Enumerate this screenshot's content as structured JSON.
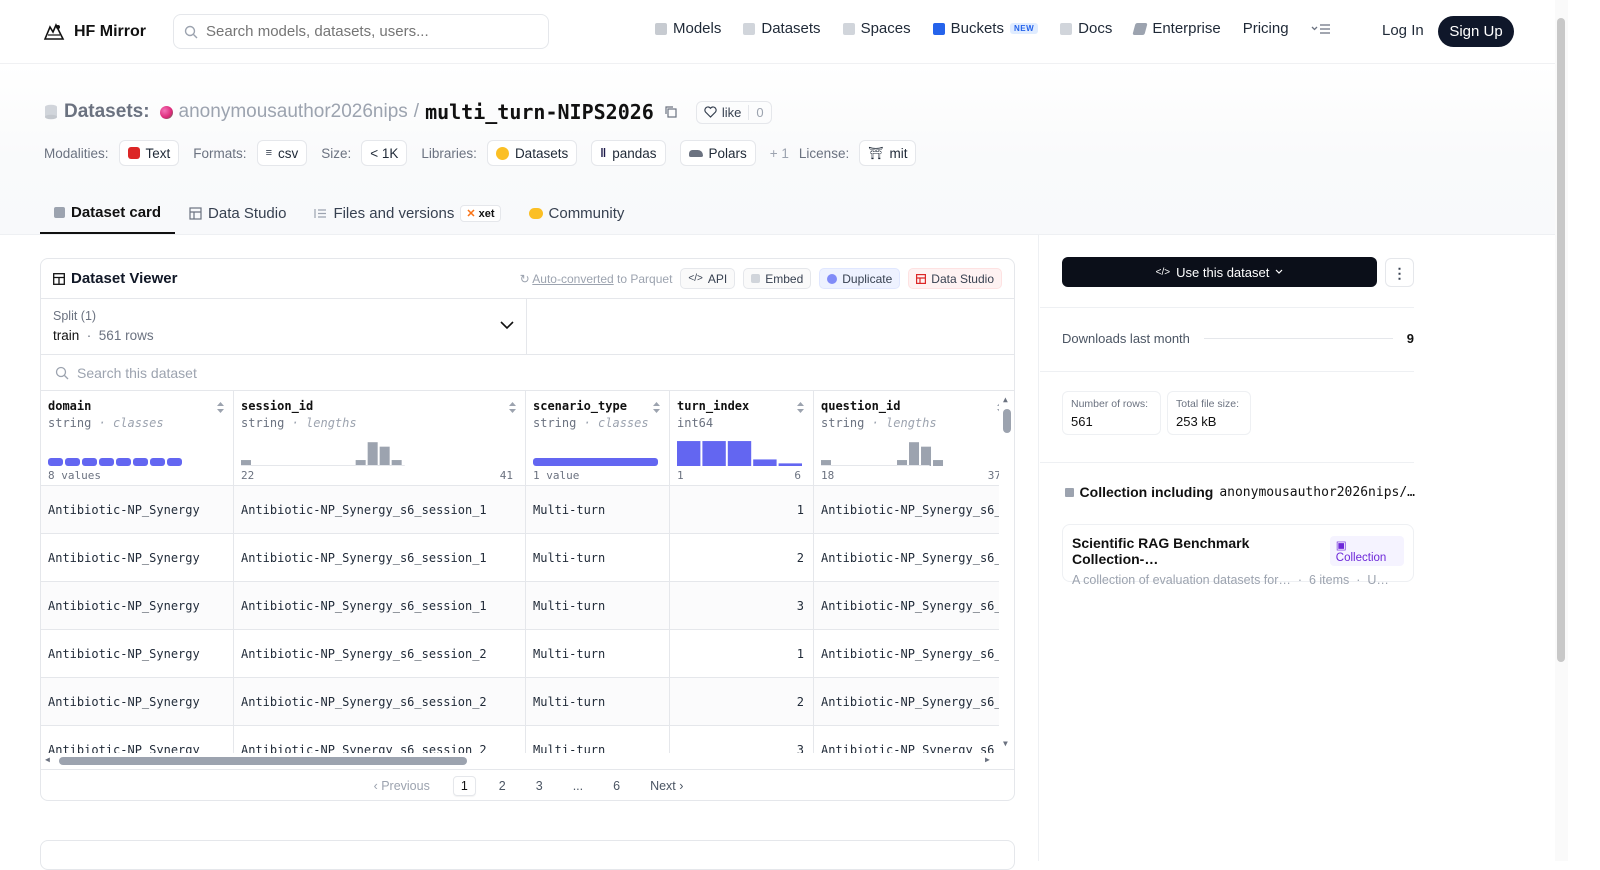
{
  "nav": {
    "brand": "HF Mirror",
    "search_placeholder": "Search models, datasets, users...",
    "items": [
      {
        "label": "Models",
        "icon": "cube-icon",
        "color": "#9ca3af"
      },
      {
        "label": "Datasets",
        "icon": "database-icon",
        "color": "#9ca3af"
      },
      {
        "label": "Spaces",
        "icon": "grid-icon",
        "color": "#9ca3af"
      },
      {
        "label": "Buckets",
        "icon": "bucket-icon",
        "color": "#2563eb",
        "badge": "NEW"
      },
      {
        "label": "Docs",
        "icon": "book-icon",
        "color": "#9ca3af"
      },
      {
        "label": "Enterprise",
        "icon": "enterprise-icon",
        "color": "#6b7280"
      },
      {
        "label": "Pricing"
      }
    ],
    "login": "Log In",
    "signup": "Sign Up"
  },
  "header": {
    "section": "Datasets:",
    "owner": "anonymousauthor2026nips",
    "slash": "/",
    "repo": "multi_turn-NIPS2026",
    "like_label": "like",
    "like_count": "0",
    "meta": {
      "modalities_label": "Modalities:",
      "modality": "Text",
      "formats_label": "Formats:",
      "format": "csv",
      "size_label": "Size:",
      "size": "< 1K",
      "libraries_label": "Libraries:",
      "libraries": [
        "Datasets",
        "pandas",
        "Polars"
      ],
      "more_libs": "+ 1",
      "license_label": "License:",
      "license": "mit"
    }
  },
  "tabs": [
    {
      "label": "Dataset card",
      "active": true
    },
    {
      "label": "Data Studio"
    },
    {
      "label": "Files and versions",
      "badge": "xet"
    },
    {
      "label": "Community"
    }
  ],
  "viewer": {
    "title": "Dataset Viewer",
    "auto_converted": "Auto-converted",
    "to_parquet": "to Parquet",
    "buttons": [
      "API",
      "Embed",
      "Duplicate",
      "Data Studio"
    ],
    "split_label": "Split (1)",
    "split_name": "train",
    "split_dot": "·",
    "split_rows": "561 rows",
    "search_placeholder": "Search this dataset",
    "columns": [
      {
        "name": "domain",
        "type": "string",
        "kind": "classes",
        "min": "8 values",
        "max": "",
        "hist_kind": "classes",
        "bars": [
          1,
          1,
          1,
          1,
          1,
          1,
          1,
          1
        ]
      },
      {
        "name": "session_id",
        "type": "string",
        "kind": "lengths",
        "min": "22",
        "max": "41",
        "hist_kind": "bars",
        "bars": [
          0.2,
          0,
          0,
          0,
          0,
          0.2,
          0.8,
          0.65,
          0.2
        ]
      },
      {
        "name": "scenario_type",
        "type": "string",
        "kind": "classes",
        "min": "1 value",
        "max": "",
        "hist_kind": "classes",
        "bars": [
          1
        ]
      },
      {
        "name": "turn_index",
        "type": "int64",
        "kind": "",
        "min": "1",
        "max": "6",
        "hist_kind": "num",
        "bars": [
          0.95,
          0.95,
          0.95,
          0.25,
          0.1
        ]
      },
      {
        "name": "question_id",
        "type": "string",
        "kind": "lengths",
        "min": "18",
        "max": "37",
        "hist_kind": "bars",
        "bars": [
          0.2,
          0,
          0,
          0,
          0,
          0.2,
          0.8,
          0.65,
          0.2
        ]
      }
    ],
    "rows": [
      [
        "Antibiotic-NP_Synergy",
        "Antibiotic-NP_Synergy_s6_session_1",
        "Multi-turn",
        "1",
        "Antibiotic-NP_Synergy_s6_"
      ],
      [
        "Antibiotic-NP_Synergy",
        "Antibiotic-NP_Synergy_s6_session_1",
        "Multi-turn",
        "2",
        "Antibiotic-NP_Synergy_s6_"
      ],
      [
        "Antibiotic-NP_Synergy",
        "Antibiotic-NP_Synergy_s6_session_1",
        "Multi-turn",
        "3",
        "Antibiotic-NP_Synergy_s6_"
      ],
      [
        "Antibiotic-NP_Synergy",
        "Antibiotic-NP_Synergy_s6_session_2",
        "Multi-turn",
        "1",
        "Antibiotic-NP_Synergy_s6_"
      ],
      [
        "Antibiotic-NP_Synergy",
        "Antibiotic-NP_Synergy_s6_session_2",
        "Multi-turn",
        "2",
        "Antibiotic-NP_Synergy_s6_"
      ],
      [
        "Antibiotic-NP_Synergy",
        "Antibiotic-NP_Synergy_s6_session_2",
        "Multi-turn",
        "3",
        "Antibiotic-NP_Synergy_s6_"
      ]
    ],
    "pager": {
      "prev": "Previous",
      "pages": [
        "1",
        "2",
        "3",
        "...",
        "6"
      ],
      "current": "1",
      "next": "Next"
    }
  },
  "sidebar": {
    "use_dataset": "Use this dataset",
    "downloads_label": "Downloads last month",
    "downloads_value": "9",
    "rows_label": "Number of rows:",
    "rows_value": "561",
    "size_label": "Total file size:",
    "size_value": "253 kB",
    "collection_heading": "Collection including",
    "collection_repo": "anonymousauthor2026nips/…",
    "collection_title": "Scientific RAG Benchmark Collection-…",
    "collection_badge": "Collection",
    "collection_desc": "A collection of evaluation datasets for…",
    "collection_items": "6 items",
    "collection_updated": "U…"
  },
  "colors": {
    "accent": "#6366f1",
    "brand_dark": "#0f172a",
    "hist_gray": "#9ca3af"
  }
}
